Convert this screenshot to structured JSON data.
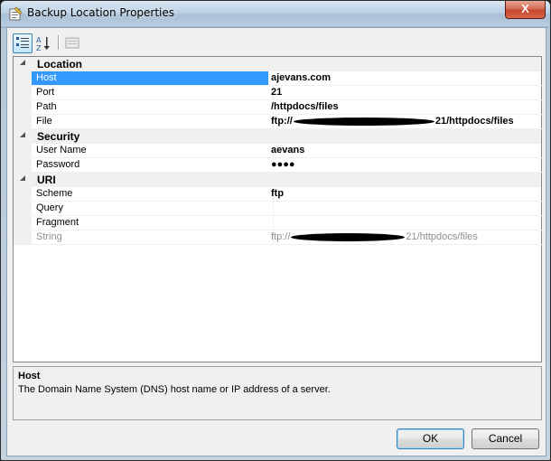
{
  "window": {
    "title": "Backup Location Properties",
    "close_glyph": "X"
  },
  "toolbar": {
    "categorized_icon": "categorized-view-icon",
    "alphabetical_icon": "alphabetical-sort-icon",
    "property_pages_icon": "property-pages-icon"
  },
  "grid": {
    "categories": [
      {
        "label": "Location",
        "properties": [
          {
            "name": "Host",
            "value": "ajevans.com",
            "selected": true
          },
          {
            "name": "Port",
            "value": "21"
          },
          {
            "name": "Path",
            "value": "/httpdocs/files"
          },
          {
            "name": "File",
            "value_prefix": "ftp://",
            "value_suffix": "21/httpdocs/files",
            "redacted": true
          }
        ]
      },
      {
        "label": "Security",
        "properties": [
          {
            "name": "User Name",
            "value": "aevans"
          },
          {
            "name": "Password",
            "value": "●●●●"
          }
        ]
      },
      {
        "label": "URI",
        "properties": [
          {
            "name": "Scheme",
            "value": "ftp"
          },
          {
            "name": "Query",
            "value": ""
          },
          {
            "name": "Fragment",
            "value": ""
          },
          {
            "name": "String",
            "value_prefix": "ftp://",
            "value_suffix": "21/httpdocs/files",
            "redacted": true,
            "readonly": true
          }
        ]
      }
    ]
  },
  "description": {
    "title": "Host",
    "text": "The Domain Name System (DNS) host name or IP address of a server."
  },
  "buttons": {
    "ok": "OK",
    "cancel": "Cancel"
  }
}
